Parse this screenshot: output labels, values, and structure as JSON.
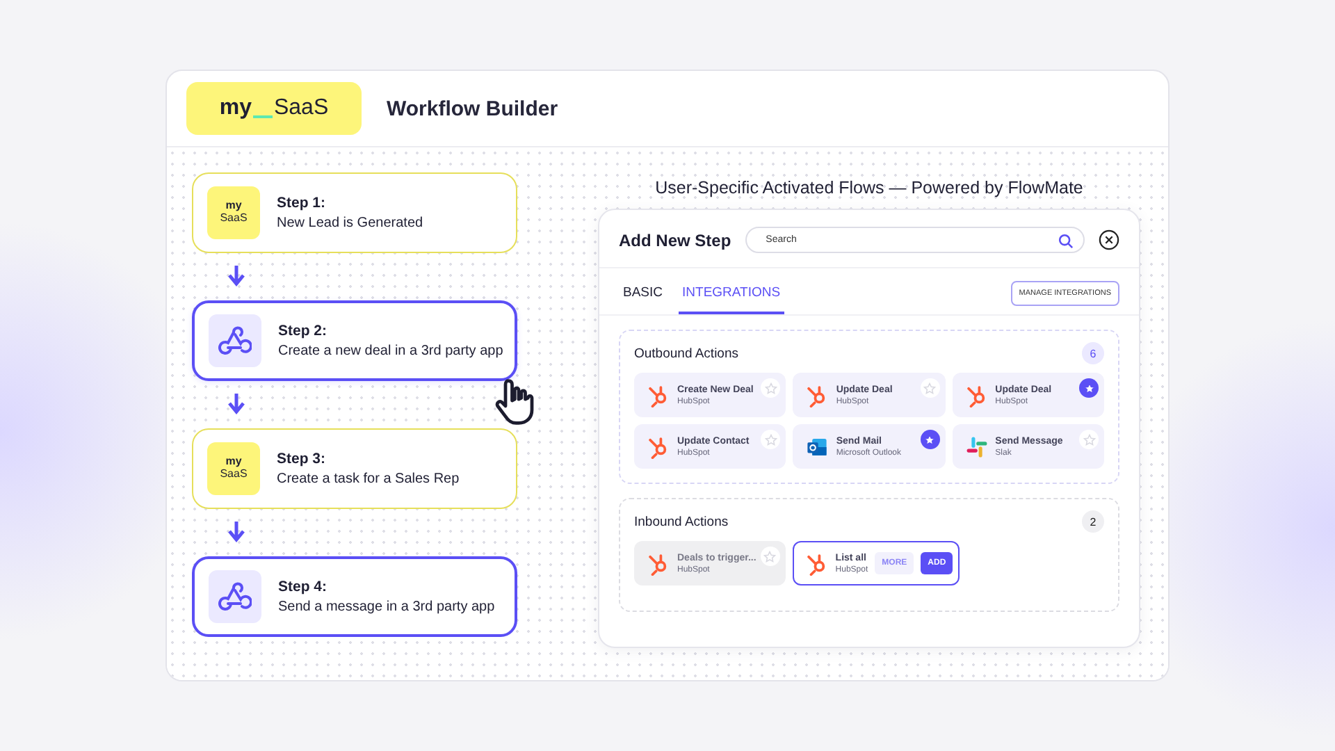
{
  "header": {
    "logo": {
      "first": "my",
      "second": "SaaS"
    },
    "title": "Workflow Builder"
  },
  "steps": [
    {
      "label": "Step 1:",
      "text": "New Lead is Generated",
      "kind": "saas",
      "logo": [
        "my",
        "SaaS"
      ],
      "hovered": false
    },
    {
      "label": "Step 2:",
      "text": "Create a new deal in a 3rd party app",
      "kind": "webhook",
      "hovered": true
    },
    {
      "label": "Step 3:",
      "text": "Create a task for a Sales Rep",
      "kind": "saas",
      "logo": [
        "my",
        "SaaS"
      ],
      "hovered": false
    },
    {
      "label": "Step 4:",
      "text": "Send a message in a 3rd party app",
      "kind": "webhook",
      "hovered": false
    }
  ],
  "flows_title": "User-Specific Activated Flows — Powered by FlowMate",
  "modal": {
    "title": "Add New Step",
    "search": {
      "placeholder": "Search"
    },
    "tabs": [
      {
        "label": "BASIC",
        "selected": false
      },
      {
        "label": "INTEGRATIONS",
        "selected": true
      }
    ],
    "manage_button": "MANAGE INTEGRATIONS",
    "sections": [
      {
        "title": "Outbound Actions",
        "count": "6",
        "kind": "outbound",
        "actions": [
          {
            "name": "Create New Deal",
            "app": "HubSpot",
            "kind": "hubspot",
            "favorite": false,
            "disabled": false
          },
          {
            "name": "Update Deal",
            "app": "HubSpot",
            "kind": "hubspot",
            "favorite": false,
            "disabled": false
          },
          {
            "name": "Update Deal",
            "app": "HubSpot",
            "kind": "hubspot",
            "favorite": true,
            "disabled": false
          },
          {
            "name": "Update Contact",
            "app": "HubSpot",
            "kind": "hubspot",
            "favorite": false,
            "disabled": false
          },
          {
            "name": "Send Mail",
            "app": "Microsoft Outlook",
            "kind": "outlook",
            "favorite": true,
            "disabled": false
          },
          {
            "name": "Send Message",
            "app": "Slak",
            "kind": "slack",
            "favorite": false,
            "disabled": false
          }
        ]
      },
      {
        "title": "Inbound Actions",
        "count": "2",
        "kind": "inbound",
        "actions": [
          {
            "name": "Deals to trigger...",
            "app": "HubSpot",
            "kind": "hubspot",
            "favorite": false,
            "disabled": true
          },
          {
            "name": "List all",
            "app": "HubSpot",
            "kind": "hubspot",
            "disabled": false,
            "buttons": [
              "MORE",
              "ADD"
            ]
          }
        ]
      }
    ]
  }
}
